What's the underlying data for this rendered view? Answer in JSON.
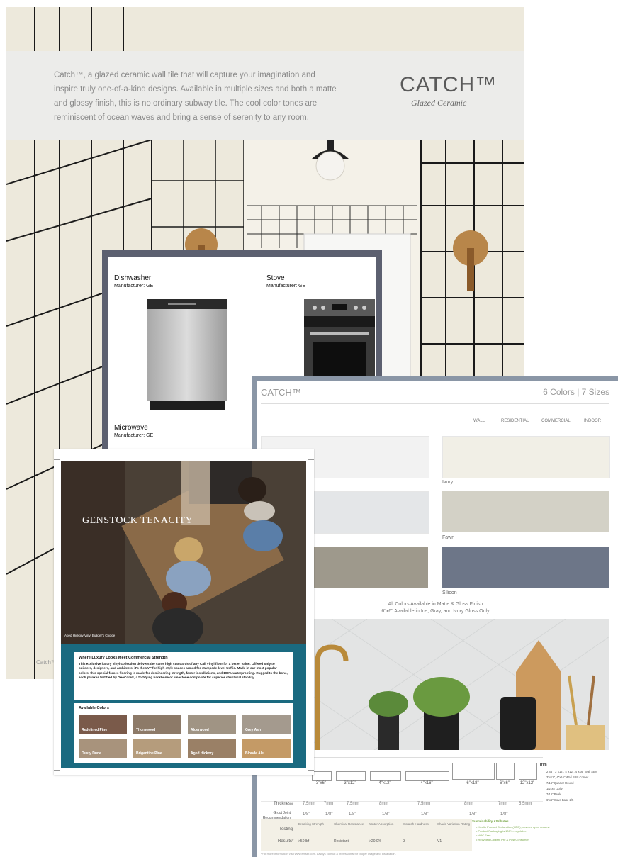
{
  "catch_brochure": {
    "description": "Catch™, a glazed ceramic wall tile that will capture your imagination and inspire truly one-of-a-kind designs. Available in multiple sizes and both a matte and glossy finish, this is no ordinary subway tile. The cool color tones are reminiscent of ocean waves and bring a sense of serenity to any room.",
    "brand": "CATCH™",
    "subtitle": "Glazed Ceramic",
    "footer": "Catch™"
  },
  "appliances": {
    "items": [
      {
        "name": "Dishwasher",
        "manufacturer": "Manufacturer: GE"
      },
      {
        "name": "Stove",
        "manufacturer": "Manufacturer: GE"
      },
      {
        "name": "Microwave",
        "manufacturer": "Manufacturer: GE"
      }
    ]
  },
  "spec_sheet": {
    "title": "CATCH™",
    "subtitle": "6 Colors | 7 Sizes",
    "usage": [
      "WALL",
      "RESIDENTIAL",
      "COMMERCIAL",
      "INDOOR"
    ],
    "colors": [
      {
        "name": "",
        "hex": "#f2f2f2"
      },
      {
        "name": "Ivory",
        "hex": "#f1efe6"
      },
      {
        "name": "",
        "hex": "#e4e6e8"
      },
      {
        "name": "Fawn",
        "hex": "#d3d1c6"
      },
      {
        "name": "",
        "hex": "#9e998c"
      },
      {
        "name": "Silicon",
        "hex": "#6d7688"
      }
    ],
    "note_line1": "All Colors Available in Matte & Gloss Finish",
    "note_line2": "6\"x6\" Available in Ice, Gray, and Ivory Gloss Only",
    "sizes": [
      "3\"x6\"",
      "3\"x12\"",
      "4\"x12\"",
      "4\"x16\"",
      "6\"x18\"",
      "6\"x6\"",
      "12\"x12\""
    ],
    "thickness_label": "Thickness",
    "thickness": [
      "7.5mm",
      "7mm",
      "7.5mm",
      "8mm",
      "7.5mm",
      "8mm",
      "7mm",
      "5.5mm"
    ],
    "grout_label": "Grout Joint Recommendation",
    "grout": [
      "1/8\"",
      "1/8\"",
      "1/8\"",
      "1/8\"",
      "1/8\"",
      "1/8\"",
      "1/8\""
    ],
    "testing_label": "Testing",
    "testing": [
      "Breaking Strength",
      "Chemical Resistance",
      "Water Absorption",
      "Scratch Hardness",
      "Shade Variation Rating"
    ],
    "results_label": "Results*",
    "results": [
      ">50 lbf",
      "Resistant",
      ">20.0%",
      "3",
      "V1"
    ],
    "trims_label": "Trim",
    "trims": [
      "2\"x6\", 3\"x12\", 4\"x12\", 4\"x16\" Wall SBN",
      "3\"x12\", 4\"x16\" Wall SBN Corner",
      "7/16\" Quarter Round",
      "1/2\"x8\" Jolly",
      "7/16\" Beak",
      "6\"x6\" Cove Base 2/5"
    ],
    "sustainability_title": "Sustainability Attributes",
    "sustainability": [
      "Health Product Declaration (HPD) provided upon request",
      "Product Packaging is 100% recyclable",
      "VOC Free",
      "Recycled Content Pre & Post Consumer"
    ],
    "footer": "*For more information visit www.emser.com. Always consult a professional for proper usage and installation."
  },
  "genstock": {
    "title": "GENSTOCK TENACITY",
    "photo_caption": "Aged Hickory Vinyl Builder's Choice",
    "heading": "Where Luxury Looks Meet Commercial Strength",
    "body": "This exclusive luxury vinyl collection delivers the same high standards of any Cali Vinyl floor for a better value. Offered only to builders, designers, and architects, it's the LVP for high-style spaces armed for stampede-level traffic. Made in our most popular colors, this special forces flooring is made for domineering strength, faster installations, and 100% waterproofing. Rugged to the bone, each plank is fortified by GeoCore®, a fortifying backbone of limestone composite for superior structural stability.",
    "colors_heading": "Available Colors",
    "colors": [
      {
        "name": "Redefined Pine",
        "hex": "#7a5a4a"
      },
      {
        "name": "Thornwood",
        "hex": "#8d7a68"
      },
      {
        "name": "Alderwood",
        "hex": "#a09484"
      },
      {
        "name": "Grey Ash",
        "hex": "#a49a8e"
      },
      {
        "name": "Dusty Dune",
        "hex": "#a8937c"
      },
      {
        "name": "Brigantine Pine",
        "hex": "#b59c7c"
      },
      {
        "name": "Aged Hickory",
        "hex": "#9a8066"
      },
      {
        "name": "Blonde Ale",
        "hex": "#c49a66"
      }
    ]
  }
}
